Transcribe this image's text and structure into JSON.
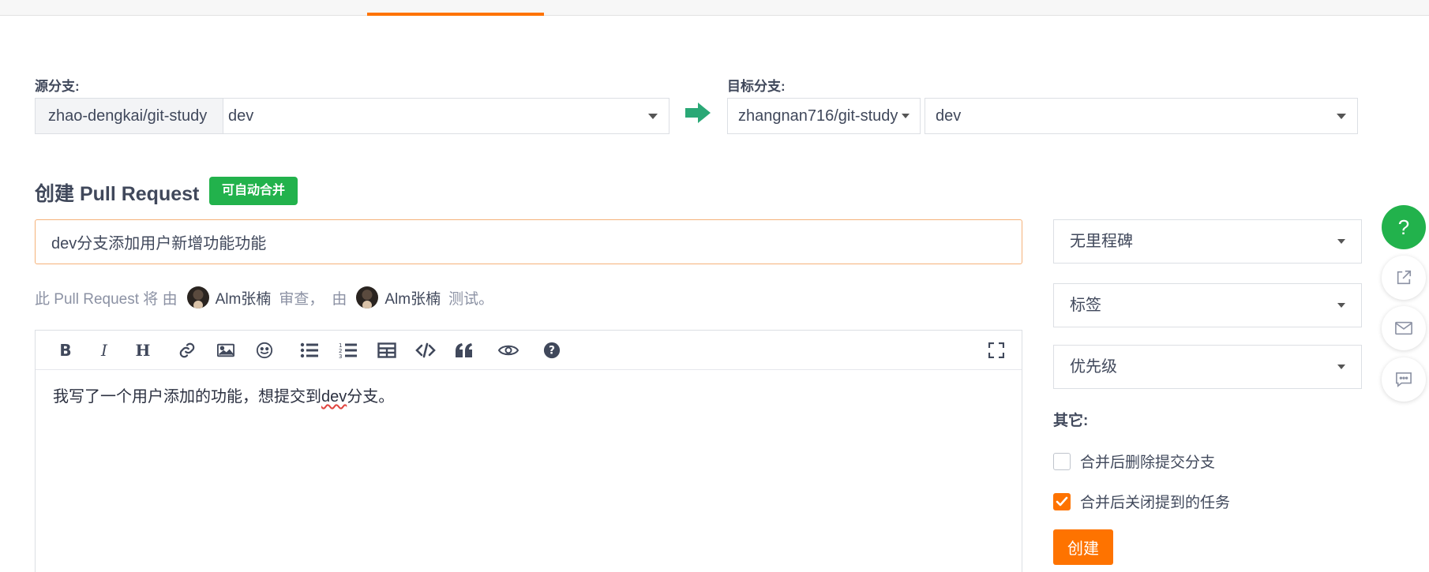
{
  "branches": {
    "source_label": "源分支:",
    "source_repo": "zhao-dengkai/git-study",
    "source_branch": "dev",
    "target_label": "目标分支:",
    "target_repo": "zhangnan716/git-study",
    "target_branch": "dev"
  },
  "pr": {
    "heading": "创建 Pull Request",
    "badge": "可自动合并",
    "title_value": "dev分支添加用户新增功能功能",
    "reviewers_prefix": "此 Pull Request 将 由",
    "reviewer_name": "Alm张楠",
    "review_action": "审查，",
    "by": "由",
    "tester_name": "Alm张楠",
    "test_action": "测试。"
  },
  "editor": {
    "toolbar": [
      "bold",
      "italic",
      "heading",
      "link",
      "image",
      "emoji",
      "bullet-list",
      "numbered-list",
      "table",
      "code",
      "quote",
      "preview",
      "help",
      "fullscreen"
    ],
    "body": "我写了一个用户添加的功能，想提交到dev分支。"
  },
  "sidebar": {
    "milestone": "无里程碑",
    "labels": "标签",
    "priority": "优先级",
    "other_label": "其它:",
    "delete_branch_label": "合并后删除提交分支",
    "delete_branch_checked": false,
    "close_tasks_label": "合并后关闭提到的任务",
    "close_tasks_checked": true,
    "create_button": "创建"
  },
  "floating": {
    "help": "?"
  },
  "colors": {
    "accent": "#fe7300",
    "success": "#22b24c",
    "arrow": "#2aa876"
  }
}
